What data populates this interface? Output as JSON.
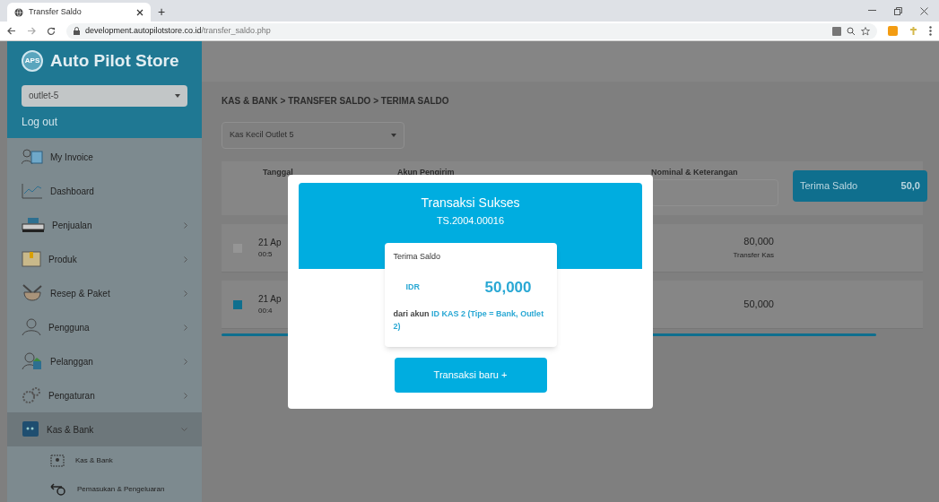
{
  "browser": {
    "tab_title": "Transfer Saldo",
    "new_tab": "+",
    "url_host": "development.autopilotstore.co.id",
    "url_path": "/transfer_saldo.php"
  },
  "sidebar": {
    "brand": "Auto Pilot Store",
    "logo_text": "APS",
    "outlet_select": {
      "value": "outlet-5"
    },
    "logout": "Log out",
    "items": [
      {
        "label": "My Invoice",
        "expandable": false,
        "selected": false
      },
      {
        "label": "Dashboard",
        "expandable": false,
        "selected": false
      },
      {
        "label": "Penjualan",
        "expandable": true,
        "expanded": false,
        "selected": false
      },
      {
        "label": "Produk",
        "expandable": true,
        "expanded": false,
        "selected": false
      },
      {
        "label": "Resep & Paket",
        "expandable": true,
        "expanded": false,
        "selected": false
      },
      {
        "label": "Pengguna",
        "expandable": true,
        "expanded": false,
        "selected": false
      },
      {
        "label": "Pelanggan",
        "expandable": true,
        "expanded": false,
        "selected": false
      },
      {
        "label": "Pengaturan",
        "expandable": true,
        "expanded": false,
        "selected": false
      },
      {
        "label": "Kas & Bank",
        "expandable": true,
        "expanded": true,
        "selected": true,
        "children": [
          {
            "label": "Kas & Bank"
          },
          {
            "label": "Pemasukan & Pengeluaran"
          }
        ]
      }
    ]
  },
  "main": {
    "breadcrumb": "KAS & BANK > TRANSFER SALDO > TERIMA SALDO",
    "account_select": {
      "value": "Kas Kecil Outlet 5"
    },
    "columns": [
      "Tanggal",
      "Akun Pengirim",
      "Nominal & Keterangan"
    ],
    "receive_button": {
      "label": "Terima Saldo",
      "amount": "50,0"
    },
    "rows": [
      {
        "checked": false,
        "date": "21 Ap",
        "time": "00:5",
        "amount": "80,000",
        "note": "Transfer Kas"
      },
      {
        "checked": true,
        "date": "21 Ap",
        "time": "00:4",
        "amount": "50,000"
      }
    ]
  },
  "modal": {
    "title": "Transaksi Sukses",
    "number": "TS.2004.00016",
    "card": {
      "title": "Terima Saldo",
      "currency": "IDR",
      "amount": "50,000",
      "source_prefix": "dari akun",
      "source_account": "ID KAS 2 (Tipe = Bank, Outlet 2)"
    },
    "button": "Transaksi baru +"
  }
}
